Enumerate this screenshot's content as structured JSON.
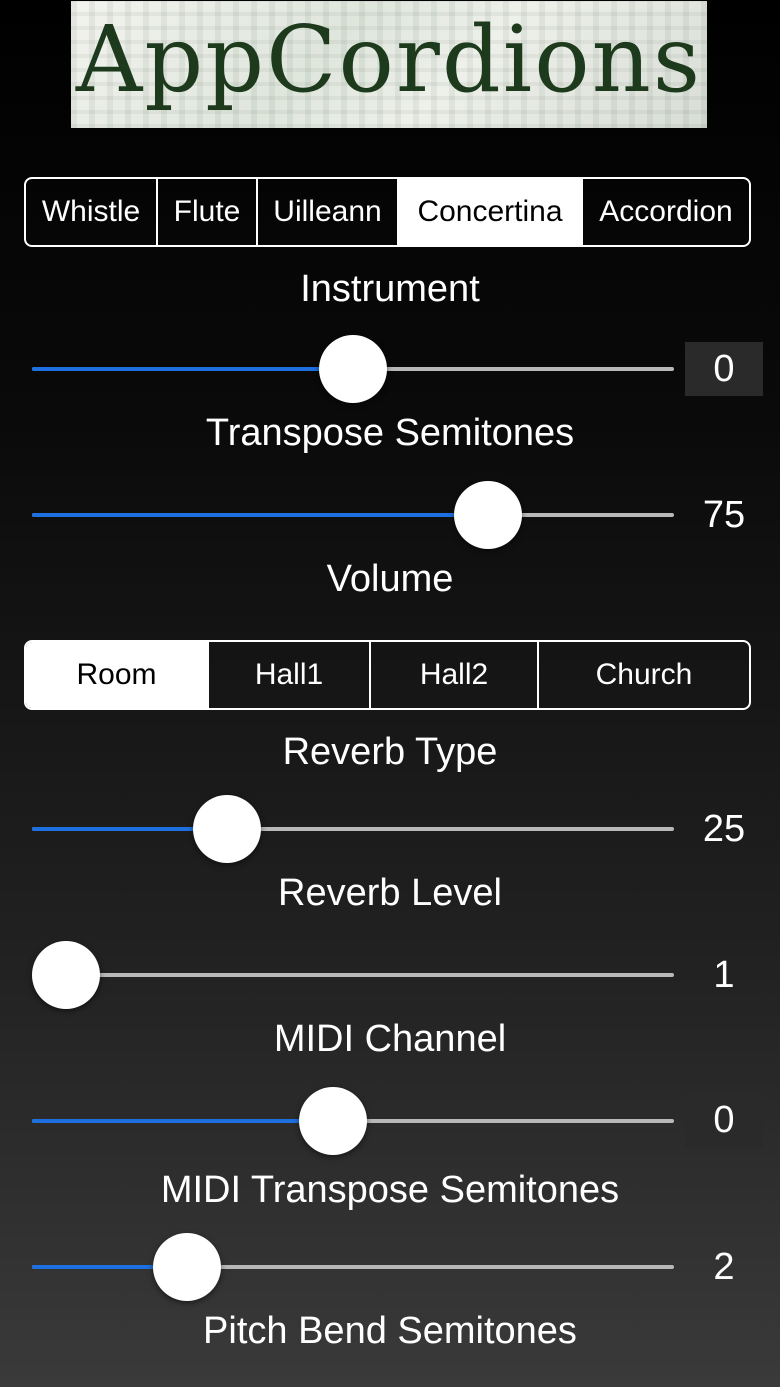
{
  "logo": {
    "text": "AppCordions"
  },
  "instrument_tabs": {
    "items": [
      {
        "label": "Whistle",
        "selected": false
      },
      {
        "label": "Flute",
        "selected": false
      },
      {
        "label": "Uilleann",
        "selected": false
      },
      {
        "label": "Concertina",
        "selected": true
      },
      {
        "label": "Accordion",
        "selected": false
      }
    ],
    "caption": "Instrument"
  },
  "transpose": {
    "value": "0",
    "fraction": 0.5,
    "caption": "Transpose Semitones"
  },
  "volume": {
    "value": "75",
    "fraction": 0.735,
    "caption": "Volume"
  },
  "reverb_tabs": {
    "items": [
      {
        "label": "Room",
        "selected": true
      },
      {
        "label": "Hall1",
        "selected": false
      },
      {
        "label": "Hall2",
        "selected": false
      },
      {
        "label": "Church",
        "selected": false
      }
    ],
    "caption": "Reverb Type"
  },
  "reverb_level": {
    "value": "25",
    "fraction": 0.28,
    "caption": "Reverb Level"
  },
  "midi_channel": {
    "value": "1",
    "fraction": 0.0,
    "caption": "MIDI Channel"
  },
  "midi_transpose": {
    "value": "0",
    "fraction": 0.465,
    "caption": "MIDI Transpose Semitones"
  },
  "pitch_bend": {
    "value": "2",
    "fraction": 0.21,
    "caption": "Pitch Bend Semitones"
  },
  "colors": {
    "accent": "#1e6fe0",
    "track": "#b8b8b8",
    "logo_text": "#1d3a1d"
  }
}
